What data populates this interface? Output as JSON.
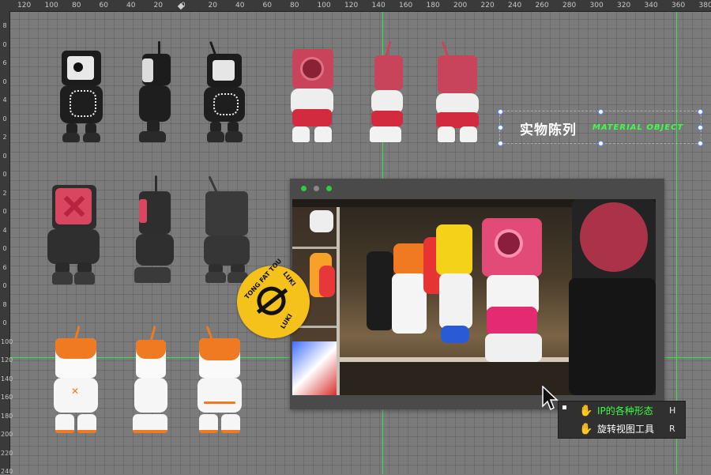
{
  "ruler": {
    "top_ticks": [
      "120",
      "100",
      "80",
      "60",
      "40",
      "20",
      "0",
      "20",
      "40",
      "60",
      "80",
      "100",
      "120",
      "140",
      "160",
      "180",
      "200",
      "220",
      "240",
      "260",
      "280",
      "300",
      "320",
      "340",
      "360",
      "380"
    ],
    "left_ticks": [
      "8",
      "0",
      "6",
      "0",
      "4",
      "0",
      "2",
      "0",
      "0",
      "2",
      "0",
      "4",
      "0",
      "6",
      "0",
      "8",
      "0",
      "1 0 0",
      "1 2 0",
      "1 4 0",
      "1 6 0",
      "1 8 0",
      "2 0 0",
      "2 2 0",
      "2 4 0"
    ]
  },
  "label": {
    "title_cn": "实物陈列",
    "title_en": "MATERIAL OBJECT"
  },
  "sticker": {
    "text_top": "TONG FAT TOU",
    "text_side": "LUKI",
    "text_bottom": "LUKI"
  },
  "shortcut_menu": {
    "items": [
      {
        "label": "IP的各种形态",
        "key": "H",
        "icon": "hand-icon",
        "color": "#3dff44"
      },
      {
        "label": "旋转视图工具",
        "key": "R",
        "icon": "rotate-hand-icon",
        "color": "#ffffff"
      }
    ]
  },
  "colors": {
    "guide": "#2ee84b",
    "accent_green": "#3dff44",
    "window_dot": "#2ecc40"
  }
}
